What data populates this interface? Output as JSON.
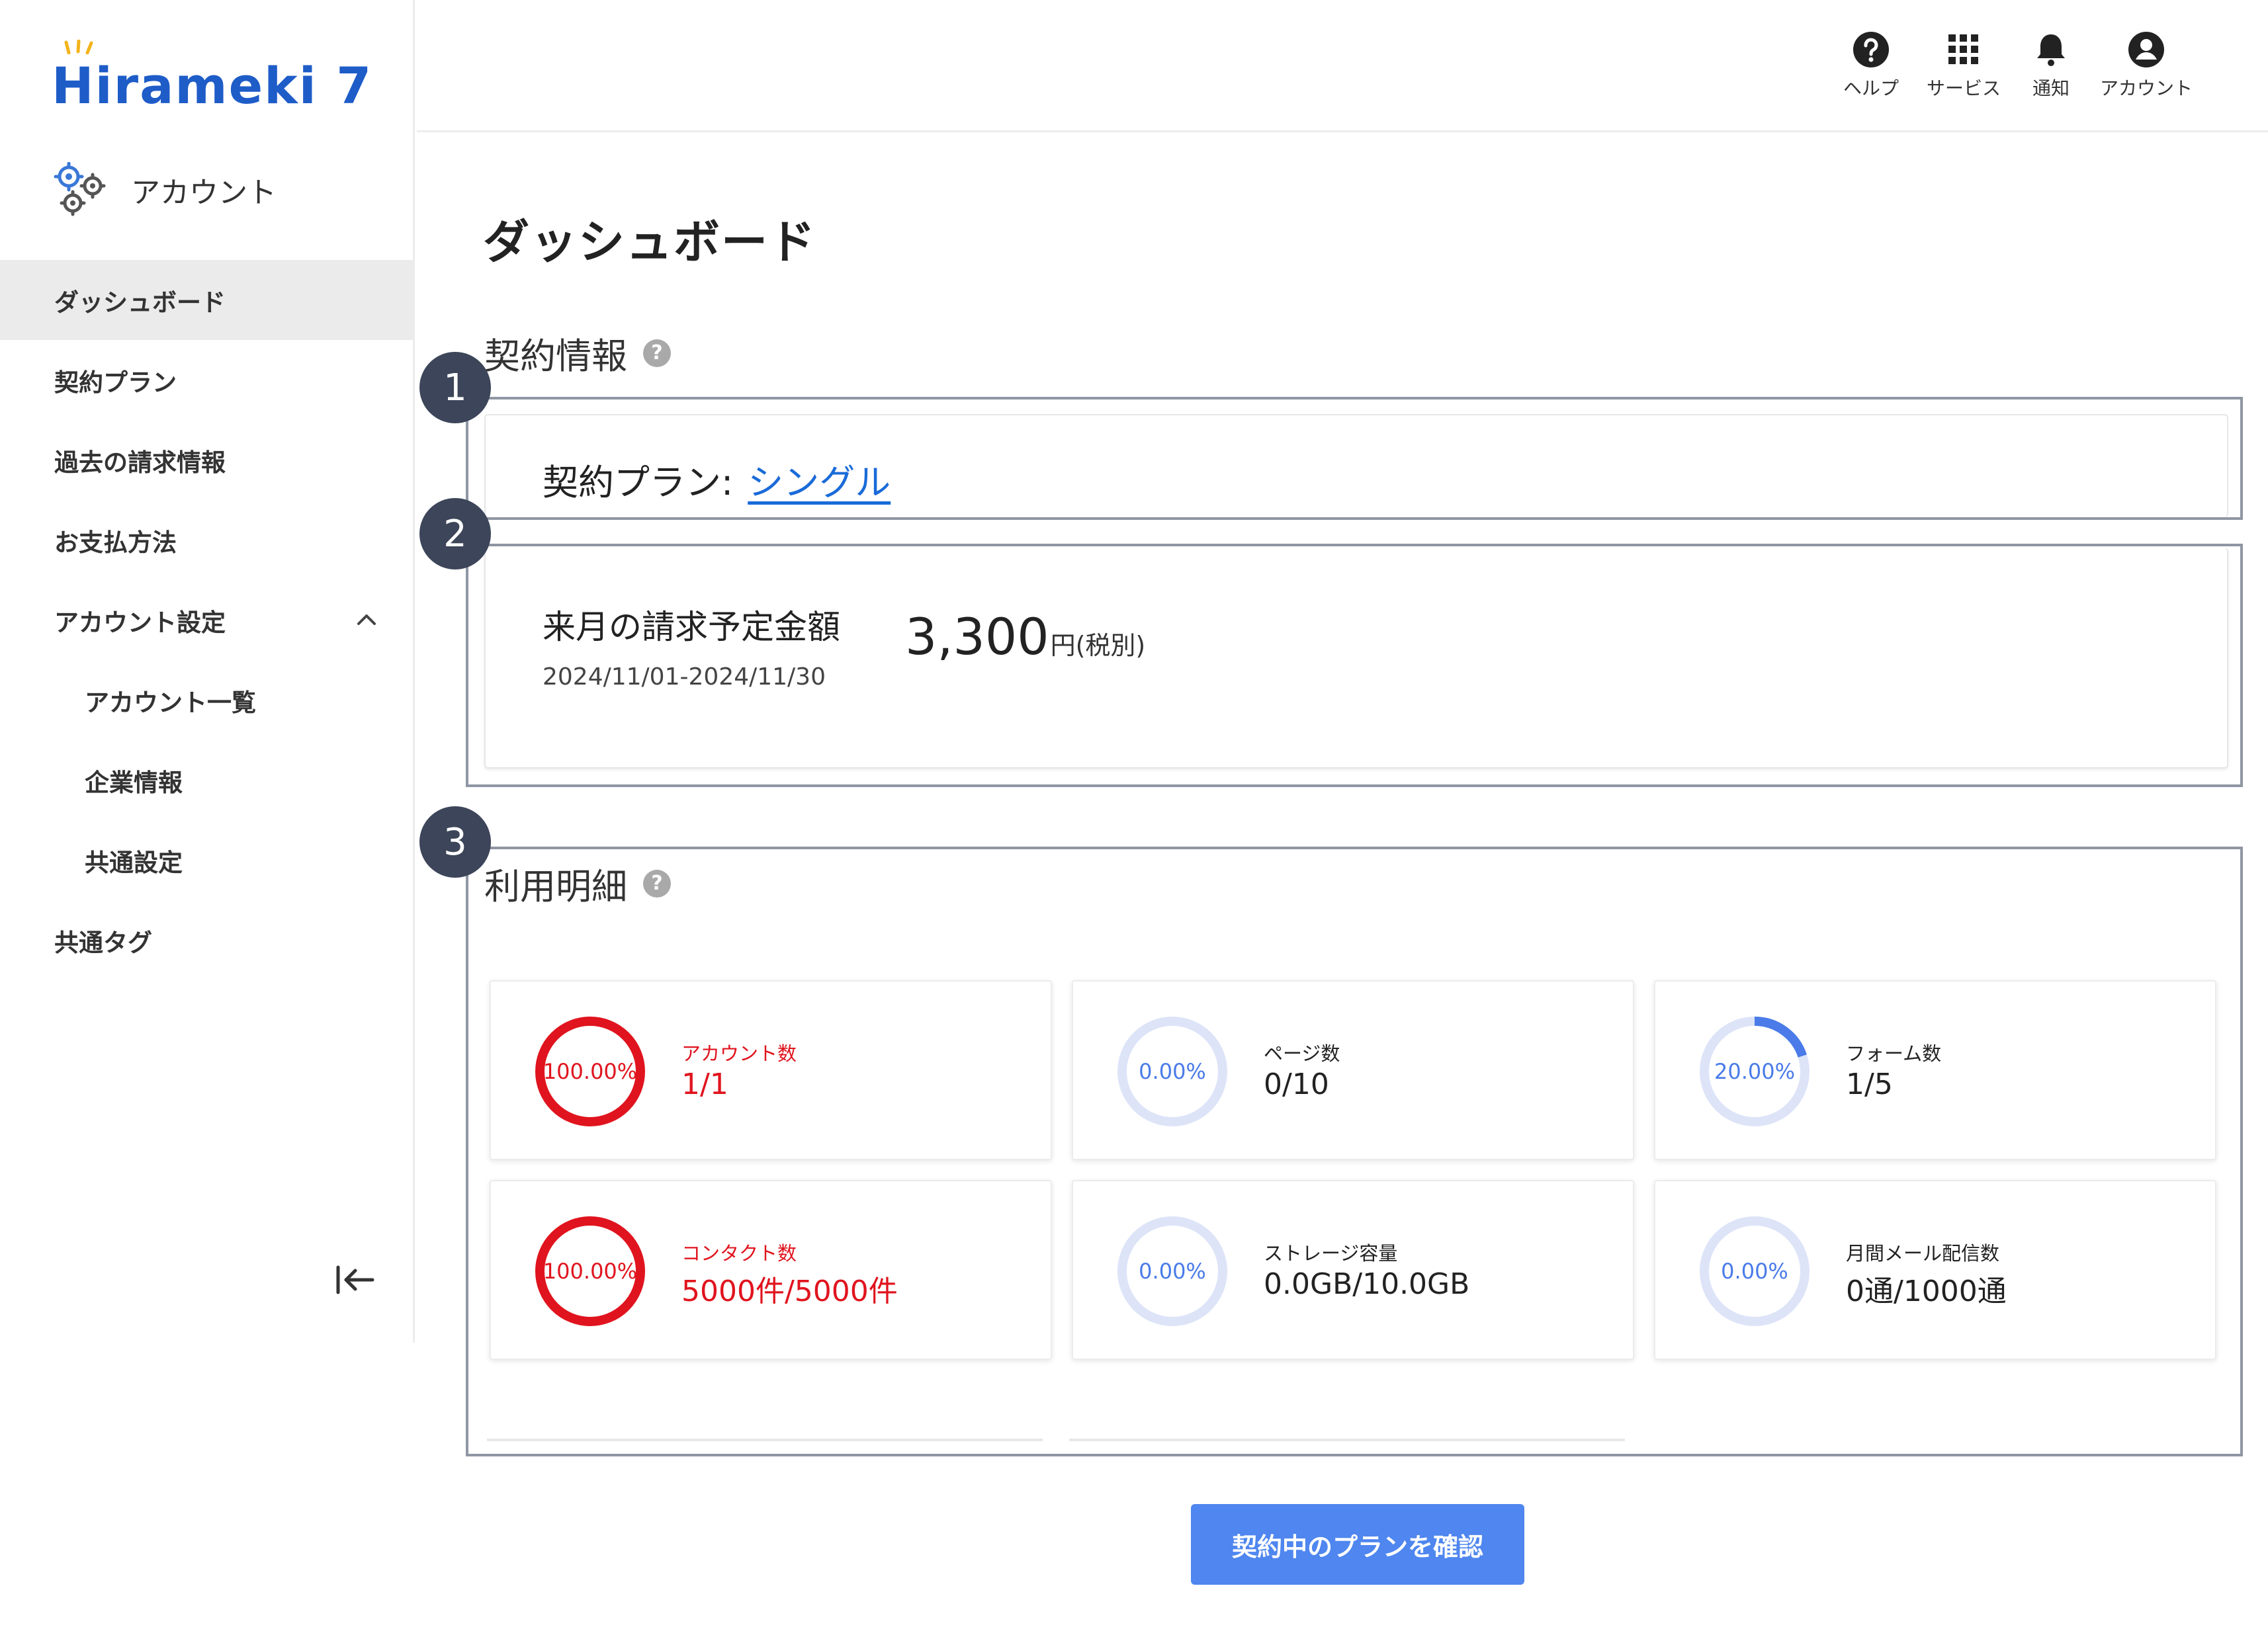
{
  "brand": {
    "logo_text": "Hirameki 7"
  },
  "sidebar": {
    "section_title": "アカウント",
    "items": [
      {
        "label": "ダッシュボード"
      },
      {
        "label": "契約プラン"
      },
      {
        "label": "過去の請求情報"
      },
      {
        "label": "お支払方法"
      },
      {
        "label": "アカウント設定"
      },
      {
        "label": "アカウント一覧"
      },
      {
        "label": "企業情報"
      },
      {
        "label": "共通設定"
      },
      {
        "label": "共通タグ"
      }
    ]
  },
  "header": {
    "help": "ヘルプ",
    "services": "サービス",
    "notifications": "通知",
    "account": "アカウント"
  },
  "main": {
    "page_title": "ダッシュボード",
    "contract_section": "契約情報",
    "plan_label": "契約プラン:",
    "plan_name": "シングル",
    "billing_label": "来月の請求予定金額",
    "billing_period": "2024/11/01-2024/11/30",
    "billing_amount": "3,300",
    "billing_unit": "円(税別)",
    "usage_section": "利用明細",
    "help_mark": "?",
    "confirm_button": "契約中のプランを確認"
  },
  "badges": [
    "1",
    "2",
    "3"
  ],
  "metrics": [
    {
      "label": "アカウント数",
      "value": "1/1",
      "percent_text": "100.00%",
      "percent": 100,
      "alert": true
    },
    {
      "label": "ページ数",
      "value": "0/10",
      "percent_text": "0.00%",
      "percent": 0,
      "alert": false
    },
    {
      "label": "フォーム数",
      "value": "1/5",
      "percent_text": "20.00%",
      "percent": 20,
      "alert": false
    },
    {
      "label": "コンタクト数",
      "value": "5000件/5000件",
      "percent_text": "100.00%",
      "percent": 100,
      "alert": true
    },
    {
      "label": "ストレージ容量",
      "value": "0.0GB/10.0GB",
      "percent_text": "0.00%",
      "percent": 0,
      "alert": false
    },
    {
      "label": "月間メール配信数",
      "value": "0通/1000通",
      "percent_text": "0.00%",
      "percent": 0,
      "alert": false
    }
  ],
  "colors": {
    "brand": "#1e5cc8",
    "link": "#1a6bd8",
    "alert": "#e0141e",
    "ring_track": "#dde4f8",
    "ring_fill": "#4a7be8",
    "button": "#4f86ef",
    "badge": "#3c4559"
  }
}
